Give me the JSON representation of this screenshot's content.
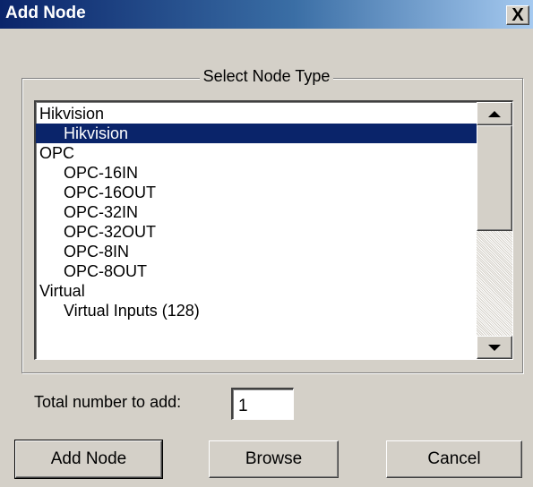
{
  "window": {
    "title": "Add Node",
    "close_label": "X"
  },
  "group": {
    "legend": "Select Node Type"
  },
  "node_list": {
    "items": [
      {
        "label": "Hikvision",
        "indent": false,
        "selected": false
      },
      {
        "label": "Hikvision",
        "indent": true,
        "selected": true
      },
      {
        "label": "OPC",
        "indent": false,
        "selected": false
      },
      {
        "label": "OPC-16IN",
        "indent": true,
        "selected": false
      },
      {
        "label": "OPC-16OUT",
        "indent": true,
        "selected": false
      },
      {
        "label": "OPC-32IN",
        "indent": true,
        "selected": false
      },
      {
        "label": "OPC-32OUT",
        "indent": true,
        "selected": false
      },
      {
        "label": "OPC-8IN",
        "indent": true,
        "selected": false
      },
      {
        "label": "OPC-8OUT",
        "indent": true,
        "selected": false
      },
      {
        "label": "Virtual",
        "indent": false,
        "selected": false
      },
      {
        "label": "Virtual Inputs (128)",
        "indent": true,
        "selected": false
      }
    ]
  },
  "total": {
    "label": "Total number to add:",
    "value": "1"
  },
  "buttons": {
    "add_node": "Add Node",
    "browse": "Browse",
    "cancel": "Cancel"
  },
  "colors": {
    "selection": "#0a246a",
    "titlebar_start": "#0a246a",
    "titlebar_end": "#a6caf0",
    "face": "#d4d0c8"
  }
}
